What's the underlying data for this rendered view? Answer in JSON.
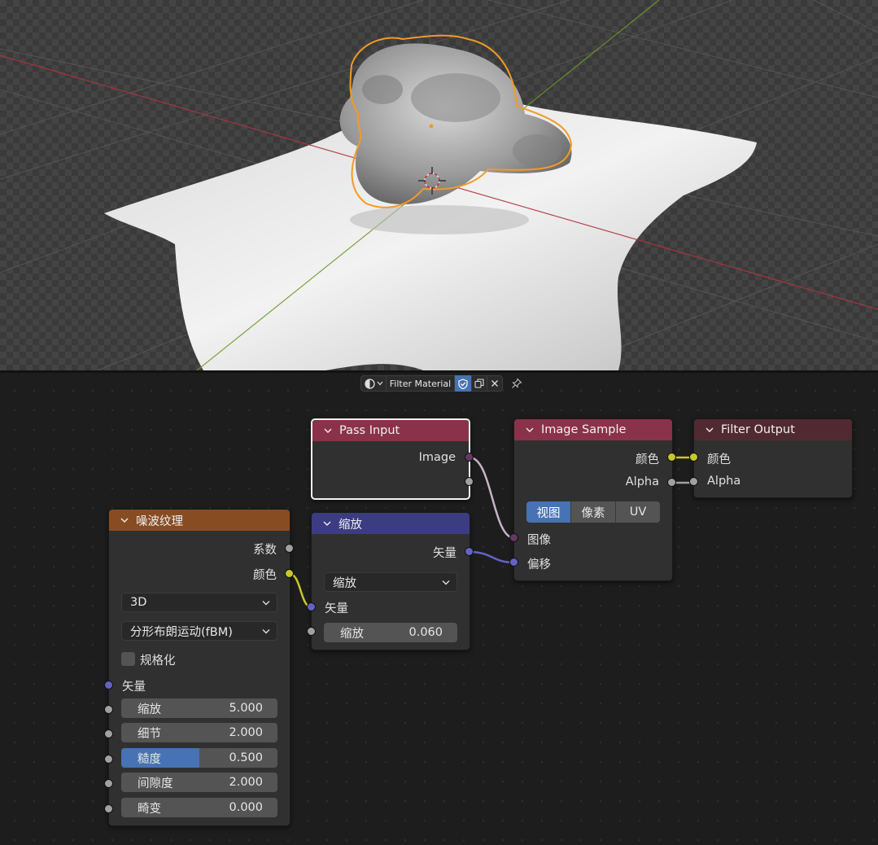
{
  "header": {
    "material_name": "Filter Material",
    "icons": [
      "shading-sphere-icon",
      "chevron-down-icon",
      "fake-user-shield-icon",
      "copy-icon",
      "close-icon",
      "pin-icon"
    ]
  },
  "nodes": {
    "pass_input": {
      "title": "Pass Input",
      "output_image": "Image",
      "color": "#8a3249"
    },
    "image_sample": {
      "title": "Image Sample",
      "color": "#8a3249",
      "output_color": "颜色",
      "output_alpha": "Alpha",
      "modes": [
        "视图",
        "像素",
        "UV"
      ],
      "active_mode": "视图",
      "input_image": "图像",
      "input_offset": "偏移"
    },
    "filter_output": {
      "title": "Filter Output",
      "input_color": "颜色",
      "input_alpha": "Alpha",
      "color": "#512a31"
    },
    "noise_texture": {
      "title": "噪波纹理",
      "color": "#884c22",
      "output_fac": "系数",
      "output_color": "颜色",
      "dimension": "3D",
      "type": "分形布朗运动(fBM)",
      "normalize": "规格化",
      "input_vector": "矢量",
      "scale_label": "缩放",
      "scale_value": "5.000",
      "detail_label": "细节",
      "detail_value": "2.000",
      "roughness_label": "糙度",
      "roughness_value": "0.500",
      "roughness_fraction": 0.5,
      "lacunarity_label": "间隙度",
      "lacunarity_value": "2.000",
      "distortion_label": "畸变",
      "distortion_value": "0.000"
    },
    "scale": {
      "title": "缩放",
      "color": "#3c3c83",
      "output_vector": "矢量",
      "operation": "缩放",
      "input_vector": "矢量",
      "scale_label": "缩放",
      "scale_value": "0.060"
    }
  },
  "colors": {
    "accent_blue": "#4772b3",
    "socket_color": "#c7c729",
    "socket_vector": "#6363c7",
    "socket_float": "#a1a1a1",
    "selection_outline": "#f29a26"
  }
}
